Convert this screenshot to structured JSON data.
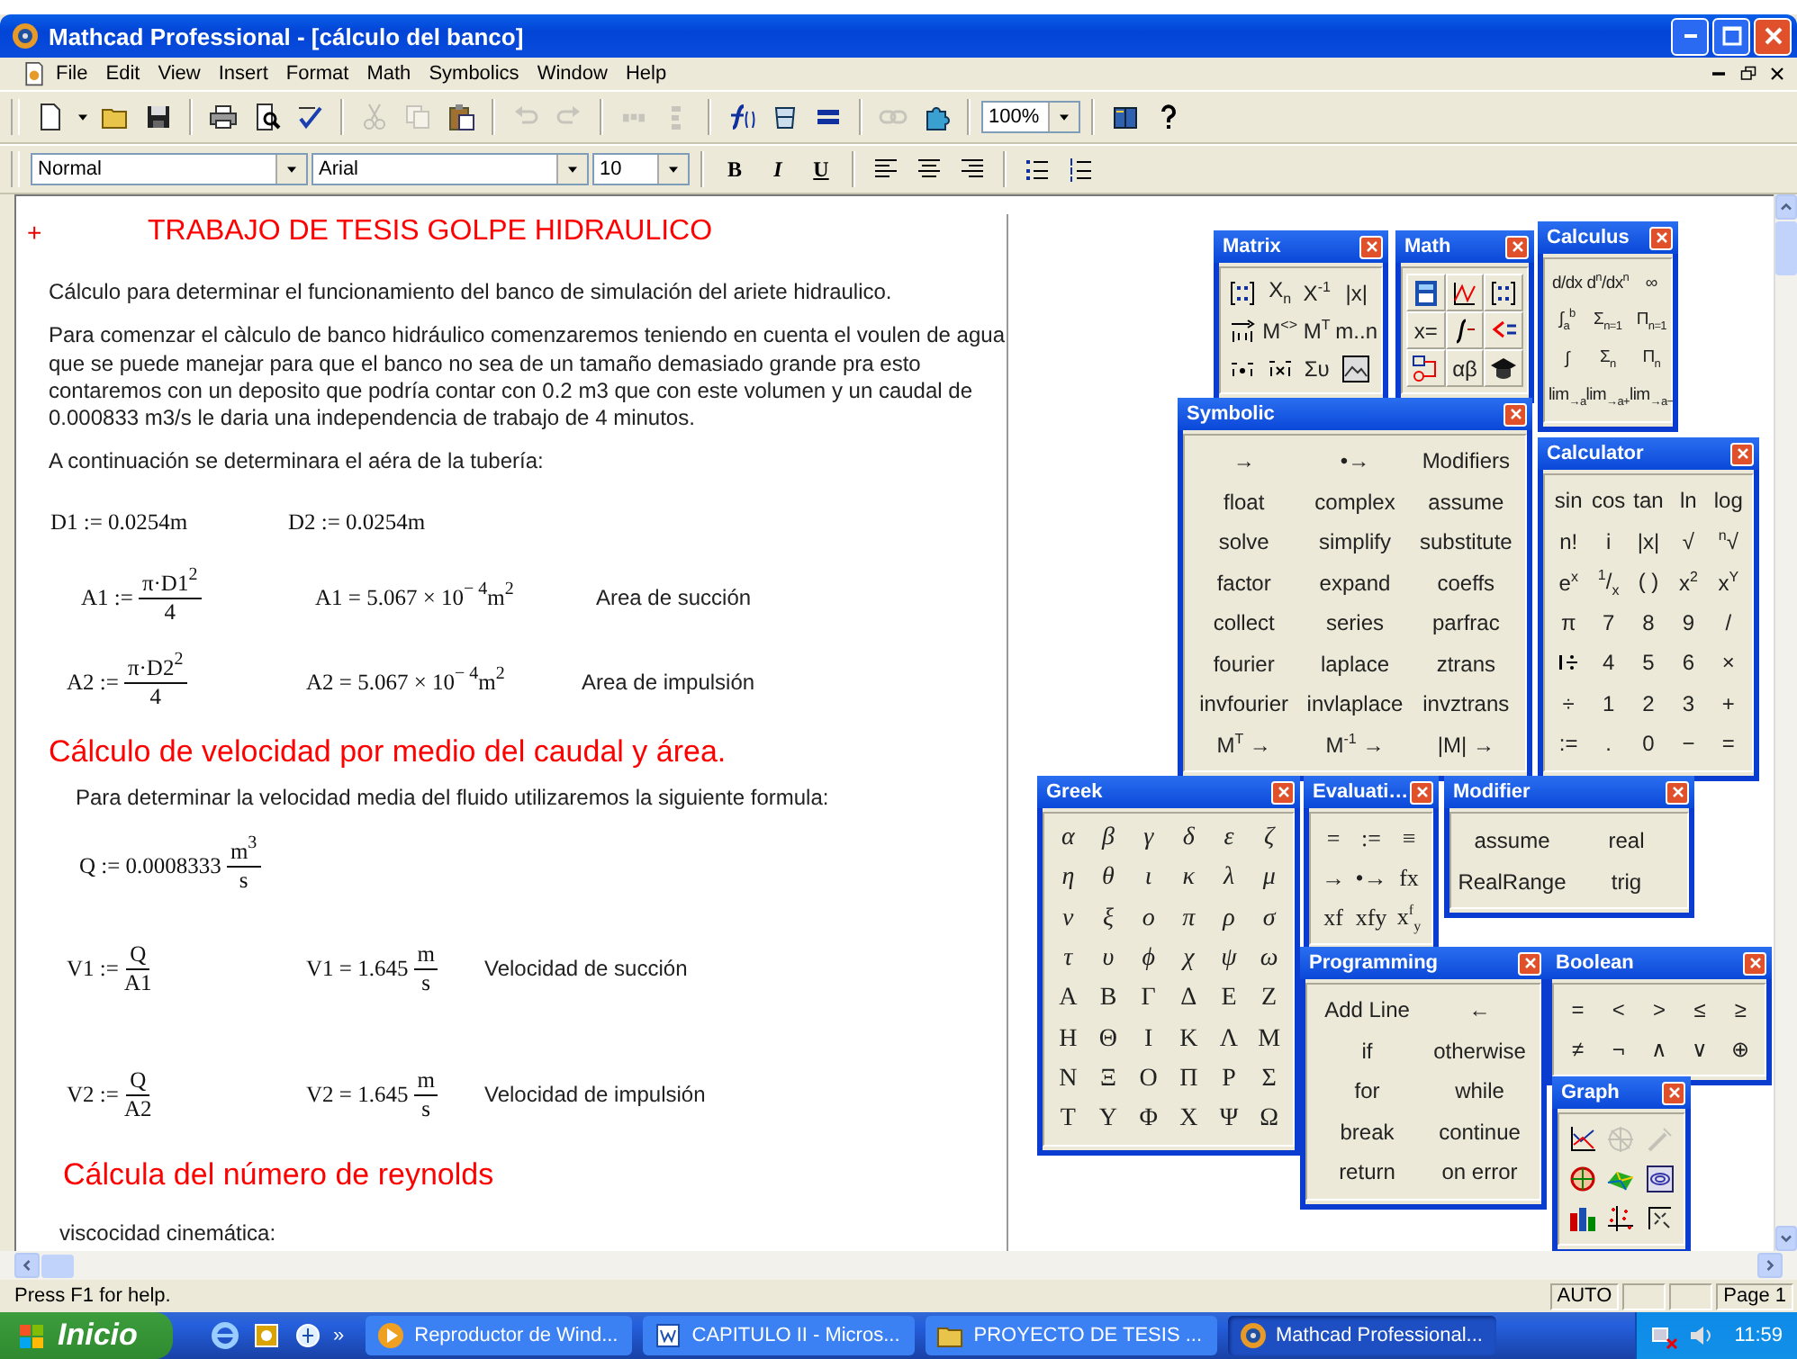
{
  "window": {
    "title": "Mathcad Professional - [cálculo del banco]"
  },
  "menu": [
    "File",
    "Edit",
    "View",
    "Insert",
    "Format",
    "Math",
    "Symbolics",
    "Window",
    "Help"
  ],
  "standard_toolbar": {
    "zoom": "100%",
    "buttons": [
      {
        "disabled": false
      },
      {
        "disabled": false
      },
      {
        "disabled": false
      },
      {
        "disabled": false
      },
      {
        "disabled": false
      },
      {
        "disabled": false
      },
      {
        "disabled": false
      },
      {
        "disabled": true
      },
      {
        "disabled": true
      },
      {
        "disabled": false
      },
      {
        "disabled": true
      },
      {
        "disabled": true
      },
      {
        "disabled": true
      },
      {
        "disabled": true
      },
      {
        "disabled": false
      },
      {
        "disabled": false
      },
      {
        "disabled": false
      },
      {
        "disabled": true
      },
      {
        "disabled": false
      },
      {
        "disabled": false
      },
      {
        "disabled": false
      }
    ]
  },
  "formatting_toolbar": {
    "style": "Normal",
    "font": "Arial",
    "size": "10",
    "buttons": [
      "B",
      "I",
      "U"
    ]
  },
  "worksheet": {
    "regions": [
      {
        "kind": "title",
        "marker": "+",
        "text": "TRABAJO DE TESIS GOLPE HIDRAULICO"
      },
      {
        "kind": "text",
        "text": "Cálculo para determinar el funcionamiento del banco de simulación del ariete hidraulico."
      },
      {
        "kind": "text",
        "text": "Para comenzar el càlculo de banco hidráulico comenzaremos teniendo en cuenta el voulen de agua que se puede manejar para que el banco no sea de un tamaño demasiado grande pra esto contaremos con un deposito que podría contar con 0.2 m3 que con este volumen y un caudal de 0.000833 m3/s le daria una independencia de trabajo de 4 minutos."
      },
      {
        "kind": "text",
        "text": "A continuación se determinara el aéra de la tubería:"
      },
      {
        "kind": "math",
        "cells": [
          {
            "kind": "expr",
            "parts": [
              {
                "kind": "text",
                "text": "D1 := 0.0254m"
              }
            ]
          },
          {
            "kind": "expr",
            "parts": [
              {
                "kind": "text",
                "text": "D2 := 0.0254m"
              }
            ]
          }
        ]
      },
      {
        "kind": "math",
        "cells": [
          {
            "kind": "expr",
            "parts": [
              {
                "kind": "text",
                "text": "A1 :="
              },
              {
                "kind": "frac",
                "num": "π·D1$^{2}$",
                "den": "4"
              }
            ]
          },
          {
            "kind": "expr",
            "parts": [
              {
                "kind": "text",
                "text": "A1 = 5.067 × 10$^{− 4}$m$^{2}$"
              }
            ]
          },
          {
            "kind": "label",
            "text": "Area de succión"
          }
        ]
      },
      {
        "kind": "math",
        "cells": [
          {
            "kind": "expr",
            "parts": [
              {
                "kind": "text",
                "text": "A2 :="
              },
              {
                "kind": "frac",
                "num": "π·D2$^{2}$",
                "den": "4"
              }
            ]
          },
          {
            "kind": "expr",
            "parts": [
              {
                "kind": "text",
                "text": "A2 = 5.067 × 10$^{− 4}$m$^{2}$"
              }
            ]
          },
          {
            "kind": "label",
            "text": "Area de impulsión"
          }
        ]
      },
      {
        "kind": "heading",
        "text": "Cálculo de velocidad por medio del caudal y área."
      },
      {
        "kind": "text",
        "text": "Para determinar la velocidad media del fluido utilizaremos la siguiente formula:"
      },
      {
        "kind": "math",
        "cells": [
          {
            "kind": "expr",
            "parts": [
              {
                "kind": "text",
                "text": "Q := 0.0008333"
              },
              {
                "kind": "frac",
                "num": "m$^{3}$",
                "den": "s"
              }
            ]
          }
        ]
      },
      {
        "kind": "math",
        "cells": [
          {
            "kind": "expr",
            "parts": [
              {
                "kind": "text",
                "text": "V1 :="
              },
              {
                "kind": "frac",
                "num": "Q",
                "den": "A1"
              }
            ]
          },
          {
            "kind": "expr",
            "parts": [
              {
                "kind": "text",
                "text": "V1 = 1.645"
              },
              {
                "kind": "frac",
                "num": "m",
                "den": "s"
              }
            ]
          },
          {
            "kind": "label",
            "text": "Velocidad de succión"
          }
        ]
      },
      {
        "kind": "math",
        "cells": [
          {
            "kind": "expr",
            "parts": [
              {
                "kind": "text",
                "text": "V2 :="
              },
              {
                "kind": "frac",
                "num": "Q",
                "den": "A2"
              }
            ]
          },
          {
            "kind": "expr",
            "parts": [
              {
                "kind": "text",
                "text": "V2 = 1.645"
              },
              {
                "kind": "frac",
                "num": "m",
                "den": "s"
              }
            ]
          },
          {
            "kind": "label",
            "text": "Velocidad de impulsión"
          }
        ]
      },
      {
        "kind": "heading",
        "text": "Cálcula del número de reynolds"
      },
      {
        "kind": "text",
        "text": "viscocidad cinemática:"
      }
    ]
  },
  "palettes": [
    {
      "title": "Matrix",
      "buttons": [
        {
          "kind": "icon"
        },
        {
          "kind": "text",
          "label": "X$_{n}$"
        },
        {
          "kind": "text",
          "label": "X$^{-1}$"
        },
        {
          "kind": "text",
          "label": "|x|"
        },
        {
          "kind": "icon"
        },
        {
          "kind": "text",
          "label": "M$^{<>}$"
        },
        {
          "kind": "text",
          "label": "M$^{T}$"
        },
        {
          "kind": "text",
          "label": "m..n"
        },
        {
          "kind": "icon"
        },
        {
          "kind": "icon"
        },
        {
          "kind": "text",
          "label": "Συ"
        },
        {
          "kind": "icon"
        }
      ]
    },
    {
      "title": "Math",
      "buttons": [
        {
          "kind": "icon"
        },
        {
          "kind": "icon"
        },
        {
          "kind": "icon"
        },
        {
          "kind": "text",
          "label": "x="
        },
        {
          "kind": "icon"
        },
        {
          "kind": "icon"
        },
        {
          "kind": "icon"
        },
        {
          "kind": "text",
          "label": "αβ"
        },
        {
          "kind": "icon"
        }
      ]
    },
    {
      "title": "Calculus",
      "buttons": [
        {
          "kind": "text",
          "label": "d/dx"
        },
        {
          "kind": "text",
          "label": "d$^{n}$/dx$^{n}$"
        },
        {
          "kind": "text",
          "label": "∞"
        },
        {
          "kind": "text",
          "label": "∫$_{a}$$^{b}$"
        },
        {
          "kind": "text",
          "label": "Σ$_{n=1}$"
        },
        {
          "kind": "text",
          "label": "Π$_{n=1}$"
        },
        {
          "kind": "text",
          "label": "∫"
        },
        {
          "kind": "text",
          "label": "Σ$_{n}$"
        },
        {
          "kind": "text",
          "label": "Π$_{n}$"
        },
        {
          "kind": "text",
          "label": "lim$_{→a}$"
        },
        {
          "kind": "text",
          "label": "lim$_{→a+}$"
        },
        {
          "kind": "text",
          "label": "lim$_{→a−}$"
        }
      ]
    },
    {
      "title": "Symbolic",
      "buttons": [
        {
          "kind": "text",
          "label": "→"
        },
        {
          "kind": "text",
          "label": "•→"
        },
        {
          "kind": "text",
          "label": "Modifiers"
        },
        {
          "kind": "text",
          "label": "float"
        },
        {
          "kind": "text",
          "label": "complex"
        },
        {
          "kind": "text",
          "label": "assume"
        },
        {
          "kind": "text",
          "label": "solve"
        },
        {
          "kind": "text",
          "label": "simplify"
        },
        {
          "kind": "text",
          "label": "substitute"
        },
        {
          "kind": "text",
          "label": "factor"
        },
        {
          "kind": "text",
          "label": "expand"
        },
        {
          "kind": "text",
          "label": "coeffs"
        },
        {
          "kind": "text",
          "label": "collect"
        },
        {
          "kind": "text",
          "label": "series"
        },
        {
          "kind": "text",
          "label": "parfrac"
        },
        {
          "kind": "text",
          "label": "fourier"
        },
        {
          "kind": "text",
          "label": "laplace"
        },
        {
          "kind": "text",
          "label": "ztrans"
        },
        {
          "kind": "text",
          "label": "invfourier"
        },
        {
          "kind": "text",
          "label": "invlaplace"
        },
        {
          "kind": "text",
          "label": "invztrans"
        },
        {
          "kind": "text",
          "label": "M$^{T}$ →"
        },
        {
          "kind": "text",
          "label": "M$^{-1}$ →"
        },
        {
          "kind": "text",
          "label": "|M| →"
        }
      ]
    },
    {
      "title": "Calculator",
      "buttons": [
        {
          "kind": "text",
          "label": "sin"
        },
        {
          "kind": "text",
          "label": "cos"
        },
        {
          "kind": "text",
          "label": "tan"
        },
        {
          "kind": "text",
          "label": "ln"
        },
        {
          "kind": "text",
          "label": "log"
        },
        {
          "kind": "text",
          "label": "n!"
        },
        {
          "kind": "text",
          "label": "i"
        },
        {
          "kind": "text",
          "label": "|x|"
        },
        {
          "kind": "text",
          "label": "√"
        },
        {
          "kind": "text",
          "label": "$^{n}$√"
        },
        {
          "kind": "text",
          "label": "e$^{x}$"
        },
        {
          "kind": "text",
          "label": "$^{1}$/$_{x}$"
        },
        {
          "kind": "text",
          "label": "( )"
        },
        {
          "kind": "text",
          "label": "x$^{2}$"
        },
        {
          "kind": "text",
          "label": "x$^{Y}$"
        },
        {
          "kind": "text",
          "label": "π"
        },
        {
          "kind": "text",
          "label": "7"
        },
        {
          "kind": "text",
          "label": "8"
        },
        {
          "kind": "text",
          "label": "9"
        },
        {
          "kind": "text",
          "label": "/"
        },
        {
          "kind": "icon"
        },
        {
          "kind": "text",
          "label": "4"
        },
        {
          "kind": "text",
          "label": "5"
        },
        {
          "kind": "text",
          "label": "6"
        },
        {
          "kind": "text",
          "label": "×"
        },
        {
          "kind": "text",
          "label": "÷"
        },
        {
          "kind": "text",
          "label": "1"
        },
        {
          "kind": "text",
          "label": "2"
        },
        {
          "kind": "text",
          "label": "3"
        },
        {
          "kind": "text",
          "label": "+"
        },
        {
          "kind": "text",
          "label": ":="
        },
        {
          "kind": "text",
          "label": "."
        },
        {
          "kind": "text",
          "label": "0"
        },
        {
          "kind": "text",
          "label": "−"
        },
        {
          "kind": "text",
          "label": "="
        }
      ]
    },
    {
      "title": "Greek",
      "buttons": [
        {
          "kind": "text",
          "label": "α"
        },
        {
          "kind": "text",
          "label": "β"
        },
        {
          "kind": "text",
          "label": "γ"
        },
        {
          "kind": "text",
          "label": "δ"
        },
        {
          "kind": "text",
          "label": "ε"
        },
        {
          "kind": "text",
          "label": "ζ"
        },
        {
          "kind": "text",
          "label": "η"
        },
        {
          "kind": "text",
          "label": "θ"
        },
        {
          "kind": "text",
          "label": "ι"
        },
        {
          "kind": "text",
          "label": "κ"
        },
        {
          "kind": "text",
          "label": "λ"
        },
        {
          "kind": "text",
          "label": "μ"
        },
        {
          "kind": "text",
          "label": "ν"
        },
        {
          "kind": "text",
          "label": "ξ"
        },
        {
          "kind": "text",
          "label": "ο"
        },
        {
          "kind": "text",
          "label": "π"
        },
        {
          "kind": "text",
          "label": "ρ"
        },
        {
          "kind": "text",
          "label": "σ"
        },
        {
          "kind": "text",
          "label": "τ"
        },
        {
          "kind": "text",
          "label": "υ"
        },
        {
          "kind": "text",
          "label": "ϕ"
        },
        {
          "kind": "text",
          "label": "χ"
        },
        {
          "kind": "text",
          "label": "ψ"
        },
        {
          "kind": "text",
          "label": "ω"
        },
        {
          "kind": "text",
          "label": "Α"
        },
        {
          "kind": "text",
          "label": "Β"
        },
        {
          "kind": "text",
          "label": "Γ"
        },
        {
          "kind": "text",
          "label": "Δ"
        },
        {
          "kind": "text",
          "label": "Ε"
        },
        {
          "kind": "text",
          "label": "Ζ"
        },
        {
          "kind": "text",
          "label": "Η"
        },
        {
          "kind": "text",
          "label": "Θ"
        },
        {
          "kind": "text",
          "label": "Ι"
        },
        {
          "kind": "text",
          "label": "Κ"
        },
        {
          "kind": "text",
          "label": "Λ"
        },
        {
          "kind": "text",
          "label": "Μ"
        },
        {
          "kind": "text",
          "label": "Ν"
        },
        {
          "kind": "text",
          "label": "Ξ"
        },
        {
          "kind": "text",
          "label": "Ο"
        },
        {
          "kind": "text",
          "label": "Π"
        },
        {
          "kind": "text",
          "label": "Ρ"
        },
        {
          "kind": "text",
          "label": "Σ"
        },
        {
          "kind": "text",
          "label": "Τ"
        },
        {
          "kind": "text",
          "label": "Υ"
        },
        {
          "kind": "text",
          "label": "Φ"
        },
        {
          "kind": "text",
          "label": "Χ"
        },
        {
          "kind": "text",
          "label": "Ψ"
        },
        {
          "kind": "text",
          "label": "Ω"
        }
      ]
    },
    {
      "title": "Evaluati…",
      "buttons": [
        {
          "kind": "text",
          "label": "="
        },
        {
          "kind": "text",
          "label": ":="
        },
        {
          "kind": "text",
          "label": "≡"
        },
        {
          "kind": "text",
          "label": "→"
        },
        {
          "kind": "text",
          "label": "•→"
        },
        {
          "kind": "text",
          "label": "fx"
        },
        {
          "kind": "text",
          "label": "xf"
        },
        {
          "kind": "text",
          "label": "xfy"
        },
        {
          "kind": "text",
          "label": "x$^{f}$$_{y}$"
        }
      ]
    },
    {
      "title": "Modifier",
      "buttons": [
        {
          "kind": "text",
          "label": "assume"
        },
        {
          "kind": "text",
          "label": "real"
        },
        {
          "kind": "text",
          "label": "RealRange"
        },
        {
          "kind": "text",
          "label": "trig"
        }
      ]
    },
    {
      "title": "Programming",
      "buttons": [
        {
          "kind": "text",
          "label": "Add Line"
        },
        {
          "kind": "text",
          "label": "←"
        },
        {
          "kind": "text",
          "label": "if"
        },
        {
          "kind": "text",
          "label": "otherwise"
        },
        {
          "kind": "text",
          "label": "for"
        },
        {
          "kind": "text",
          "label": "while"
        },
        {
          "kind": "text",
          "label": "break"
        },
        {
          "kind": "text",
          "label": "continue"
        },
        {
          "kind": "text",
          "label": "return"
        },
        {
          "kind": "text",
          "label": "on error"
        }
      ]
    },
    {
      "title": "Boolean",
      "buttons": [
        {
          "kind": "text",
          "label": "="
        },
        {
          "kind": "text",
          "label": "<"
        },
        {
          "kind": "text",
          "label": ">"
        },
        {
          "kind": "text",
          "label": "≤"
        },
        {
          "kind": "text",
          "label": "≥"
        },
        {
          "kind": "text",
          "label": "≠"
        },
        {
          "kind": "text",
          "label": "¬"
        },
        {
          "kind": "text",
          "label": "∧"
        },
        {
          "kind": "text",
          "label": "∨"
        },
        {
          "kind": "text",
          "label": "⊕"
        }
      ]
    },
    {
      "title": "Graph",
      "buttons": [
        {
          "kind": "icon",
          "disabled": false
        },
        {
          "kind": "icon",
          "disabled": true
        },
        {
          "kind": "icon",
          "disabled": true
        },
        {
          "kind": "icon",
          "disabled": false
        },
        {
          "kind": "icon",
          "disabled": false
        },
        {
          "kind": "icon",
          "disabled": false
        },
        {
          "kind": "icon",
          "disabled": false
        },
        {
          "kind": "icon",
          "disabled": false
        },
        {
          "kind": "icon",
          "disabled": false
        }
      ]
    }
  ],
  "status_bar": {
    "message": "Press F1 for help.",
    "mode": "AUTO",
    "page": "Page 1"
  },
  "taskbar": {
    "start": "Inicio",
    "more": "»",
    "tasks": [
      {
        "label": "Reproductor de Wind...",
        "selected": false
      },
      {
        "label": "CAPITULO II - Micros...",
        "selected": false
      },
      {
        "label": "PROYECTO DE TESIS ...",
        "selected": false
      },
      {
        "label": "Mathcad Professional...",
        "selected": true
      }
    ],
    "clock": "11:59"
  }
}
